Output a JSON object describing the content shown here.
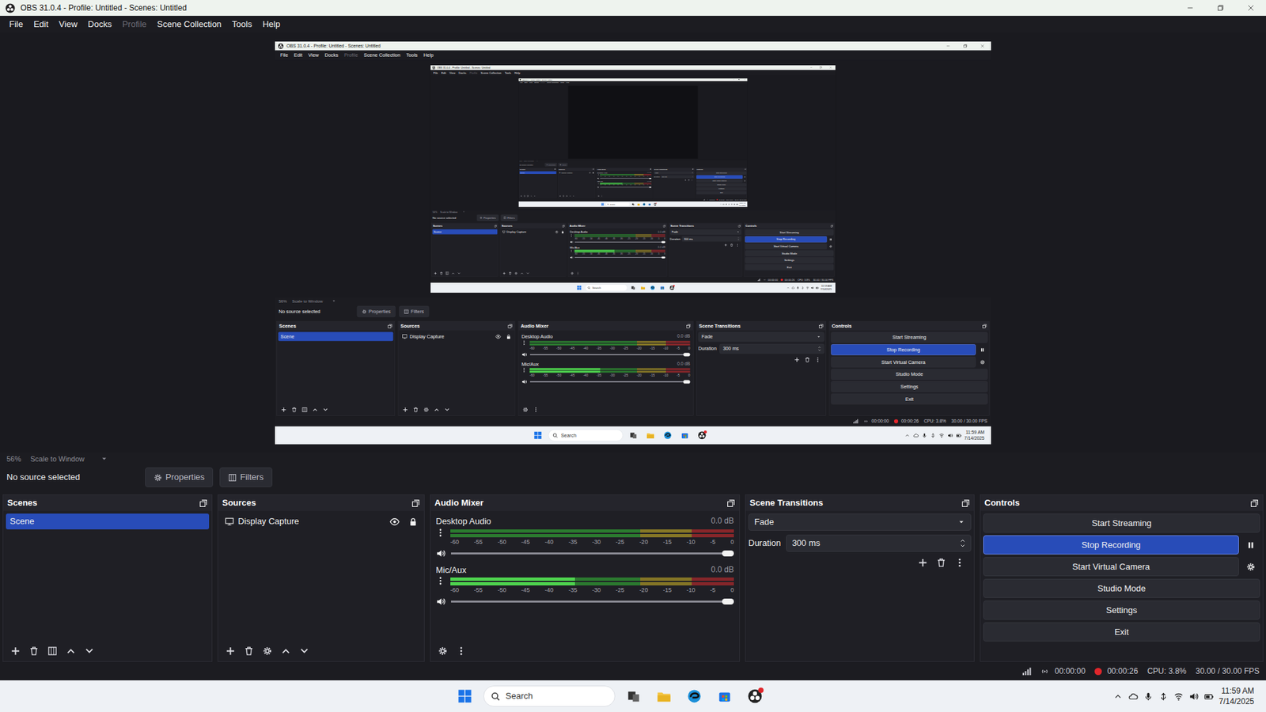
{
  "window": {
    "title": "OBS 31.0.4 - Profile: Untitled - Scenes: Untitled"
  },
  "menu": {
    "items": [
      {
        "label": "File",
        "disabled": false
      },
      {
        "label": "Edit",
        "disabled": false
      },
      {
        "label": "View",
        "disabled": false
      },
      {
        "label": "Docks",
        "disabled": false
      },
      {
        "label": "Profile",
        "disabled": true
      },
      {
        "label": "Scene Collection",
        "disabled": false
      },
      {
        "label": "Tools",
        "disabled": false
      },
      {
        "label": "Help",
        "disabled": false
      }
    ]
  },
  "preview": {
    "zoom": "56%",
    "scale_mode": "Scale to Window"
  },
  "source_bar": {
    "status": "No source selected",
    "buttons": [
      "Properties",
      "Filters"
    ]
  },
  "scenes": {
    "title": "Scenes",
    "items": [
      {
        "label": "Scene",
        "selected": true
      }
    ]
  },
  "sources": {
    "title": "Sources",
    "items": [
      {
        "label": "Display Capture",
        "selected": false,
        "visible": true,
        "locked": true
      }
    ]
  },
  "audio_mixer": {
    "title": "Audio Mixer",
    "scale": [
      "-60",
      "-55",
      "-50",
      "-45",
      "-40",
      "-35",
      "-30",
      "-25",
      "-20",
      "-15",
      "-10",
      "-5",
      "0"
    ],
    "channels": [
      {
        "name": "Desktop Audio",
        "reading": "0.0 dB",
        "level": 0,
        "volume": 1,
        "muted": false
      },
      {
        "name": "Mic/Aux",
        "reading": "0.0 dB",
        "level": 0.44,
        "volume": 1,
        "muted": false
      }
    ]
  },
  "transitions": {
    "title": "Scene Transitions",
    "selected": "Fade",
    "duration_label": "Duration",
    "duration": "300 ms"
  },
  "controls": {
    "title": "Controls",
    "buttons": [
      {
        "label": "Start Streaming",
        "active": false,
        "kind": "plain"
      },
      {
        "label": "Stop Recording",
        "active": true,
        "kind": "pause"
      },
      {
        "label": "Start Virtual Camera",
        "active": false,
        "kind": "config"
      },
      {
        "label": "Studio Mode",
        "active": false,
        "kind": "plain"
      },
      {
        "label": "Settings",
        "active": false,
        "kind": "plain"
      },
      {
        "label": "Exit",
        "active": false,
        "kind": "plain"
      }
    ]
  },
  "status_bar": {
    "stream_time": "00:00:00",
    "rec_time": "00:00:26",
    "recording": true,
    "cpu": "CPU: 3.8%",
    "fps": "30.00 / 30.00 FPS"
  },
  "taskbar": {
    "search": "Search",
    "time": "11:59 AM",
    "date": "7/14/2025"
  }
}
